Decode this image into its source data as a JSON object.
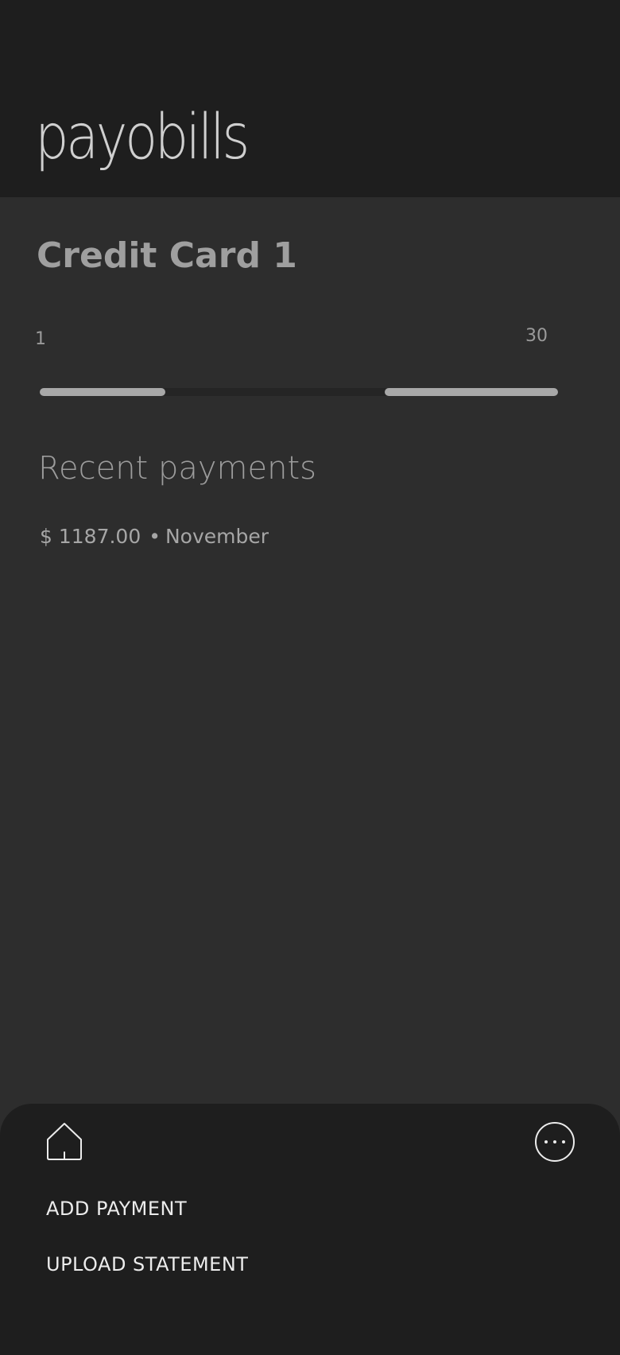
{
  "header": {
    "logo_text": "payobills"
  },
  "card": {
    "title": "Credit Card 1",
    "range": {
      "min_label": "1",
      "max_label": "30",
      "left_fill_fraction": 0.24,
      "right_fill_fraction": 0.33
    }
  },
  "recent_payments": {
    "title": "Recent payments",
    "items": [
      {
        "amount": "$ 1187.00",
        "separator": "•",
        "month": "November"
      }
    ]
  },
  "bottom_sheet": {
    "home_icon": "home-icon",
    "more_icon": "more-horizontal-circle-icon",
    "actions": [
      {
        "label": "ADD PAYMENT"
      },
      {
        "label": "UPLOAD STATEMENT"
      }
    ]
  },
  "colors": {
    "header_bg": "#1e1e1e",
    "content_bg": "#2d2d2d",
    "accent": "#a8a8a8",
    "action_text": "#ececec"
  }
}
